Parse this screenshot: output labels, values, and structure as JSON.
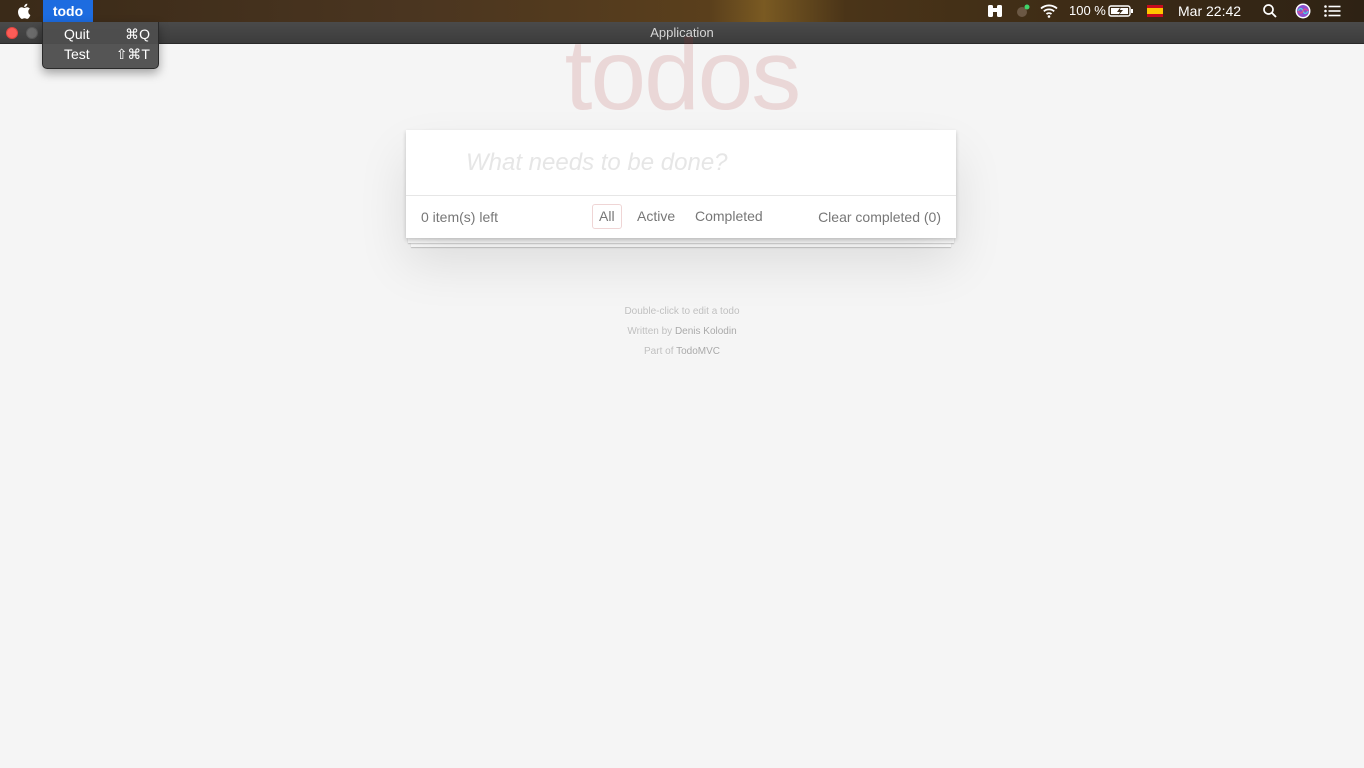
{
  "menubar": {
    "app_name": "todo",
    "battery": "100 %",
    "clock": "Mar 22:42",
    "icons": [
      "apple-icon",
      "binoculars-icon",
      "status-app-icon",
      "wifi-icon",
      "battery-charging-icon",
      "flag-spain-icon",
      "spotlight-search-icon",
      "siri-icon",
      "notification-center-icon"
    ]
  },
  "window": {
    "title": "Application"
  },
  "app_menu": {
    "items": [
      {
        "label": "Quit",
        "shortcut": "⌘Q"
      },
      {
        "label": "Test",
        "shortcut": "⇧⌘T"
      }
    ]
  },
  "todo": {
    "brand": "todos",
    "new_todo_placeholder": "What needs to be done?",
    "items_left": "0 item(s) left",
    "filters": [
      "All",
      "Active",
      "Completed"
    ],
    "selected_filter": "All",
    "clear_completed": "Clear completed (0)"
  },
  "info": {
    "hint": "Double-click to edit a todo",
    "written_by_prefix": "Written by ",
    "author": "Denis Kolodin",
    "part_of_prefix": "Part of ",
    "project": "TodoMVC"
  },
  "colors": {
    "menu_highlight": "#1d6ce0",
    "brand_text": "#af2f2f",
    "background": "#f5f5f5"
  }
}
